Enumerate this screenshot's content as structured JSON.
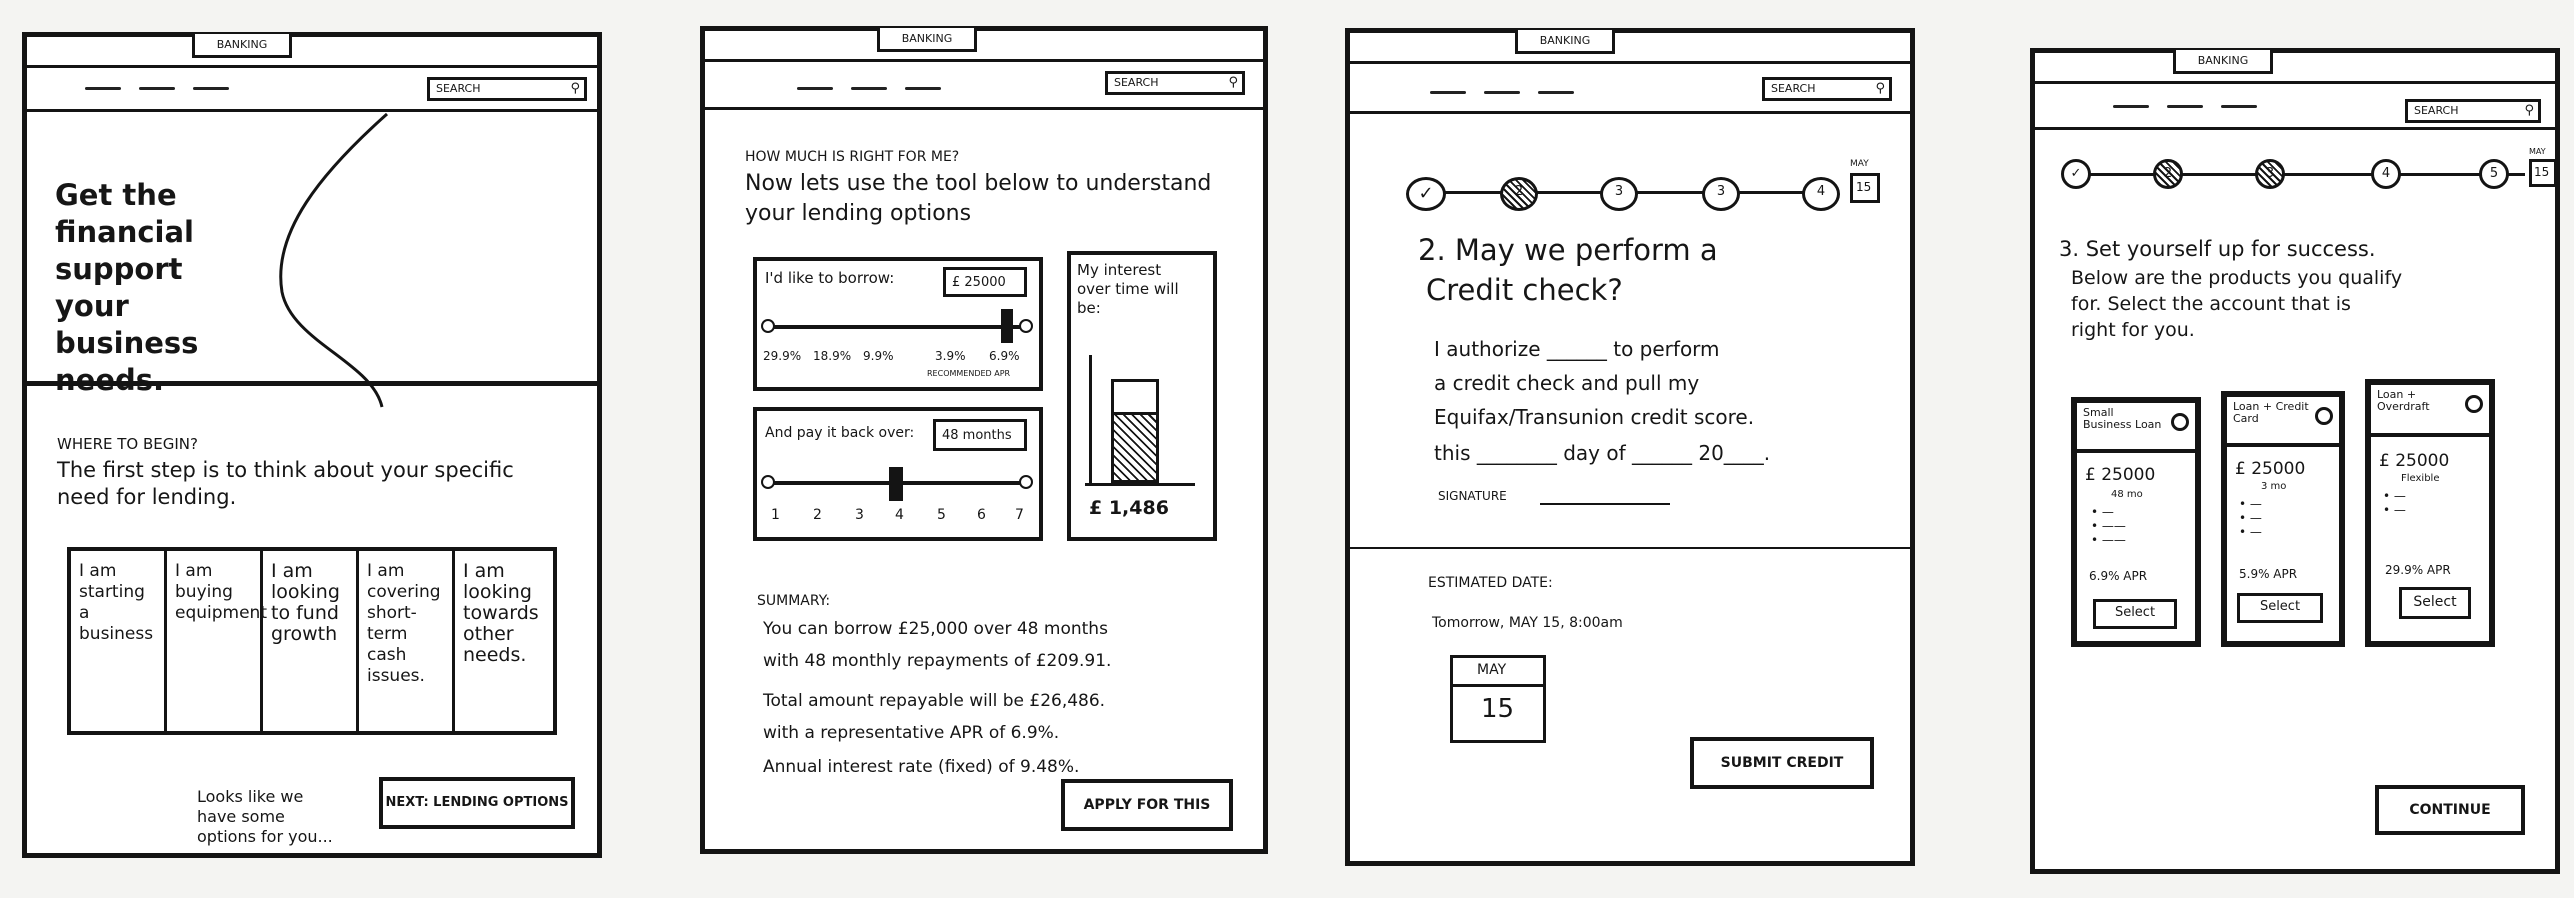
{
  "banking_tab": "BANKING",
  "search_placeholder": "SEARCH",
  "screen1": {
    "hero_title": "Get the financial support your business needs.",
    "section_label": "WHERE TO BEGIN?",
    "intro": "The first step is to think about your specific need for lending.",
    "options": [
      "I am starting a business",
      "I am buying equipment",
      "I am looking to fund growth",
      "I am covering short-term cash issues.",
      "I am looking towards other needs."
    ],
    "footer_note": "Looks like we have some options for you...",
    "next_button": "NEXT: LENDING OPTIONS"
  },
  "screen2": {
    "question": "HOW MUCH IS RIGHT FOR ME?",
    "intro": "Now lets use the tool below to understand your lending options",
    "borrow_label": "I'd like to borrow:",
    "borrow_value": "£ 25000",
    "apr_ticks": [
      "29.9%",
      "18.9%",
      "9.9%",
      "3.9%",
      "6.9%"
    ],
    "apr_caption": "RECOMMENDED APR",
    "payback_label": "And pay it back over:",
    "payback_value": "48 months",
    "month_ticks": [
      "1",
      "2",
      "3",
      "4",
      "5",
      "6",
      "7"
    ],
    "interest_title": "My interest over time will be:",
    "interest_amount": "£ 1,486",
    "summary_label": "SUMMARY:",
    "summary_lines": [
      "You can borrow £25,000 over 48 months",
      "with 48 monthly repayments of £209.91.",
      "Total amount repayable will be £26,486.",
      "with a representative APR of 6.9%.",
      "Annual interest rate (fixed) of 9.48%."
    ],
    "apply_button": "APPLY FOR THIS"
  },
  "screen3": {
    "steps": [
      "✓",
      "2",
      "3",
      "3",
      "4"
    ],
    "date_badge": {
      "month": "MAY",
      "day": "15"
    },
    "heading_lines": [
      "2. May we perform a",
      "Credit check?"
    ],
    "consent_lines": [
      "I authorize ______ to perform",
      "a credit check and pull my",
      "Equifax/Transunion credit score.",
      "this ________ day of ______ 20____."
    ],
    "signature_label": "SIGNATURE",
    "estimated_label": "ESTIMATED DATE:",
    "estimated_value": "Tomorrow, MAY 15, 8:00am",
    "cal_month": "MAY",
    "cal_day": "15",
    "submit_button": "SUBMIT CREDIT"
  },
  "screen4": {
    "steps": [
      "✓",
      "2",
      "3",
      "4",
      "5"
    ],
    "date_badge": {
      "month": "MAY",
      "day": "15"
    },
    "heading_lines": [
      "3. Set yourself up for success.",
      "Below are the products you qualify",
      "for. Select the account that is",
      "right for you."
    ],
    "accounts": [
      {
        "name": "Small Business Loan",
        "amount": "£ 25000",
        "detail": "48 mo",
        "apr": "6.9% APR",
        "button": "Select"
      },
      {
        "name": "Loan + Credit Card",
        "amount": "£ 25000",
        "detail": "3 mo",
        "apr": "5.9% APR",
        "button": "Select"
      },
      {
        "name": "Loan + Overdraft",
        "amount": "£ 25000",
        "detail": "Flexible",
        "apr": "29.9% APR",
        "button": "Select"
      }
    ],
    "continue_button": "CONTINUE"
  }
}
